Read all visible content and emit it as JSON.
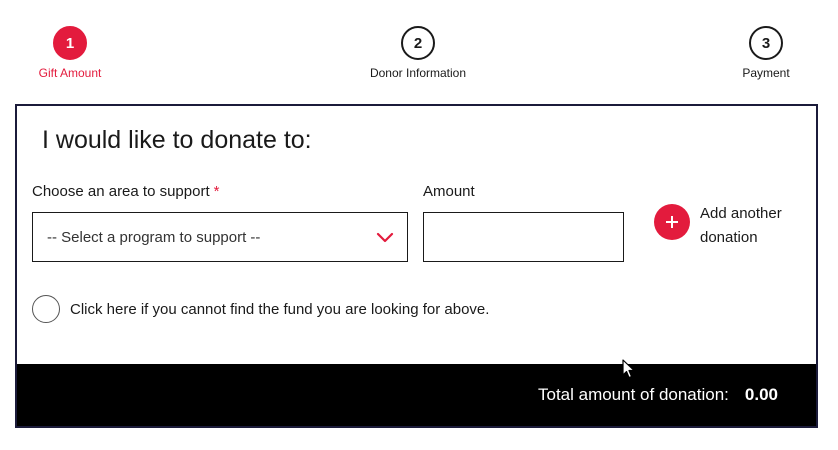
{
  "steps": [
    {
      "number": "1",
      "label": "Gift Amount",
      "active": true
    },
    {
      "number": "2",
      "label": "Donor Information",
      "active": false
    },
    {
      "number": "3",
      "label": "Payment",
      "active": false
    }
  ],
  "form": {
    "title": "I would like to donate to:",
    "area_label": "Choose an area to support",
    "required_marker": "*",
    "area_select_value": "-- Select a program to support --",
    "amount_label": "Amount",
    "amount_value": "",
    "add_another_label": "Add another donation",
    "cannot_find_label": "Click here if you cannot find the fund you are looking for above."
  },
  "total": {
    "label": "Total amount of donation:",
    "value": "0.00"
  },
  "colors": {
    "accent": "#e31b3d",
    "footer_bg": "#000000",
    "card_border": "#1b1b3a"
  },
  "icons": {
    "chevron": "chevron-down-icon",
    "add": "plus-icon",
    "cursor": "mouse-cursor-icon"
  }
}
